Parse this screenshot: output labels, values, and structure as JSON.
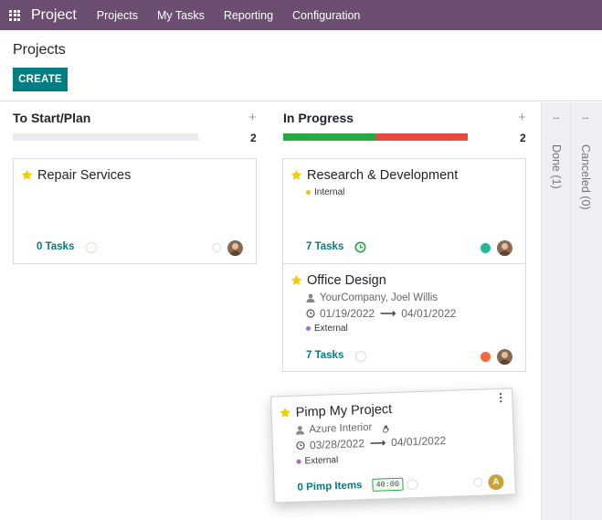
{
  "app": {
    "name": "Project"
  },
  "nav": {
    "items": [
      "Projects",
      "My Tasks",
      "Reporting",
      "Configuration"
    ]
  },
  "control_panel": {
    "title": "Projects",
    "create_label": "CREATE"
  },
  "columns": [
    {
      "title": "To Start/Plan",
      "count": "2"
    },
    {
      "title": "In Progress",
      "count": "2"
    }
  ],
  "folded_columns": [
    {
      "label": "Done (1)"
    },
    {
      "label": "Canceled (0)"
    }
  ],
  "cards": {
    "repair": {
      "title": "Repair Services",
      "tasks": "0 Tasks"
    },
    "research": {
      "title": "Research & Development",
      "tag": "Internal",
      "tasks": "7 Tasks"
    },
    "office": {
      "title": "Office Design",
      "partner": "YourCompany, Joel Willis",
      "date_start": "01/19/2022",
      "date_end": "04/01/2022",
      "tag": "External",
      "tasks": "7 Tasks"
    },
    "pimp": {
      "title": "Pimp My Project",
      "partner": "Azure Interior",
      "date_start": "03/28/2022",
      "date_end": "04/01/2022",
      "tag": "External",
      "tasks": "0 Pimp Items",
      "badge": "40:00",
      "avatar_letter": "A"
    }
  },
  "colors": {
    "navbar": "#6b4e71",
    "primary": "#017e84",
    "star": "#f3cc00",
    "green": "#28a745",
    "red": "#e84a3f",
    "internal_tag": "#f0c200",
    "external_tag": "#a16ad0"
  }
}
